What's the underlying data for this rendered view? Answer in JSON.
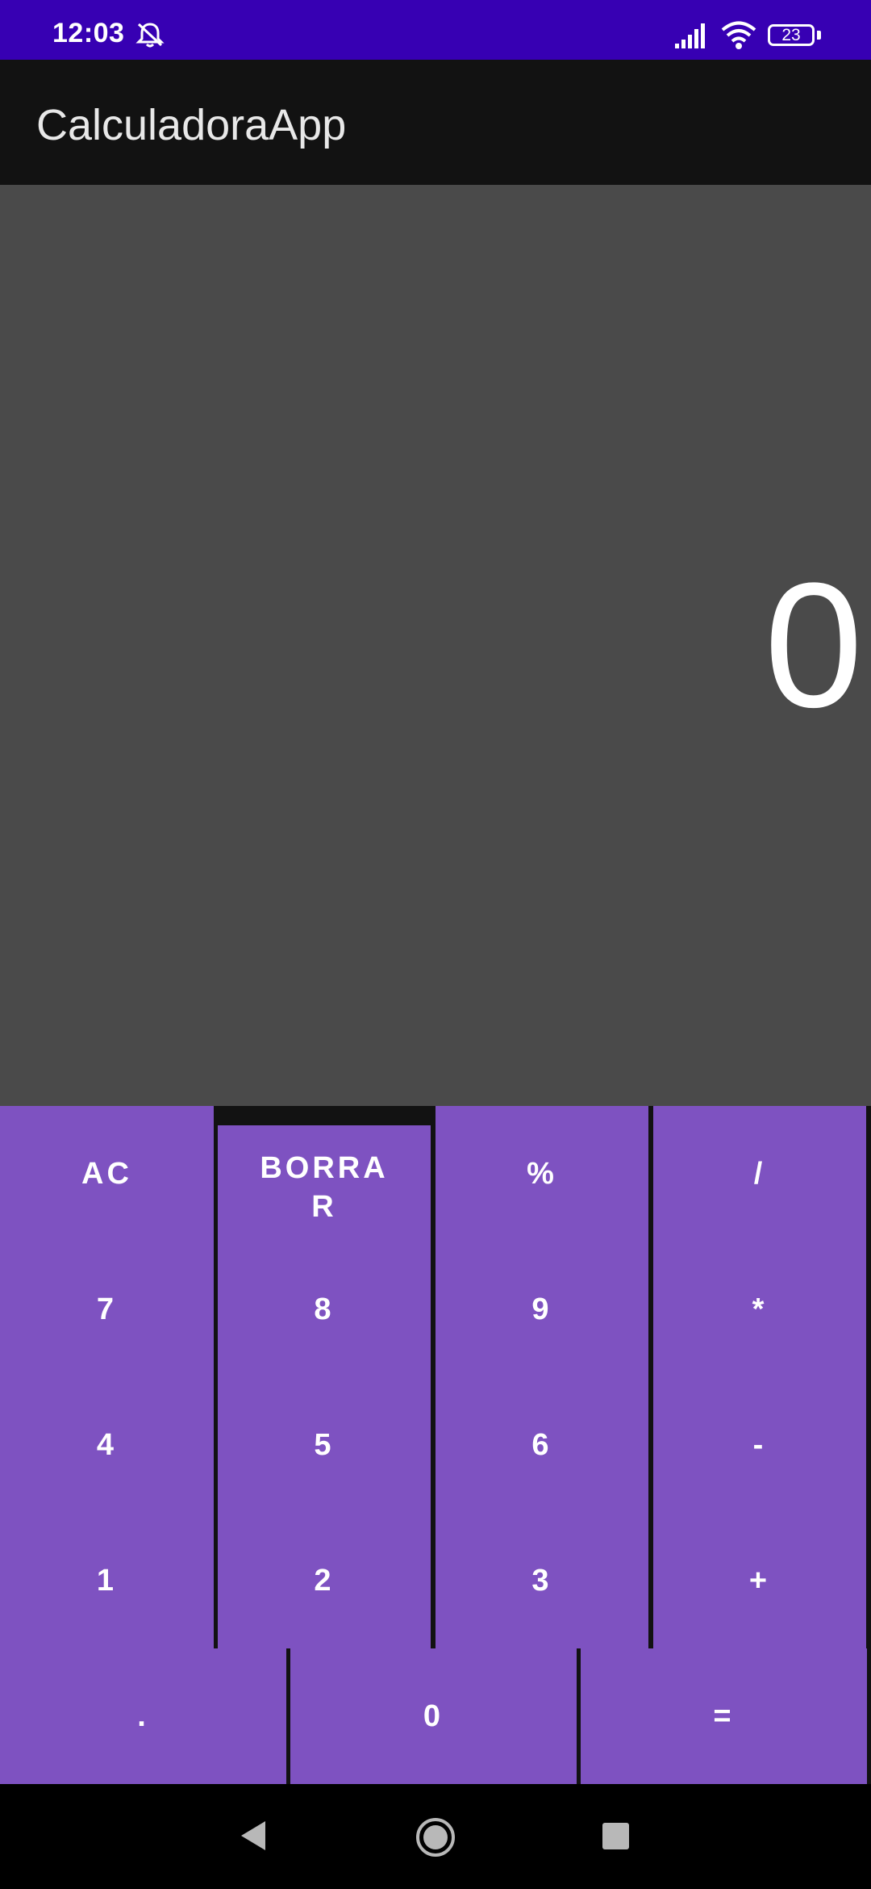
{
  "status_bar": {
    "time": "12:03",
    "battery_level": "23",
    "icons": [
      "bell-off-icon",
      "signal-icon",
      "wifi-icon",
      "battery-icon"
    ],
    "background_color": "#3700b3"
  },
  "app_bar": {
    "title": "CalculadoraApp"
  },
  "display": {
    "value": "0"
  },
  "keypad": {
    "accent_color": "#7e52c1",
    "keys": {
      "ac": "AC",
      "delete": "BORRA\nR",
      "percent": "%",
      "divide": "/",
      "seven": "7",
      "eight": "8",
      "nine": "9",
      "multiply": "*",
      "four": "4",
      "five": "5",
      "six": "6",
      "subtract": "-",
      "one": "1",
      "two": "2",
      "three": "3",
      "add": "+",
      "decimal": ".",
      "zero": "0",
      "equals": "="
    }
  },
  "nav_bar": {
    "icons": [
      "back-icon",
      "home-icon",
      "recents-icon"
    ]
  }
}
